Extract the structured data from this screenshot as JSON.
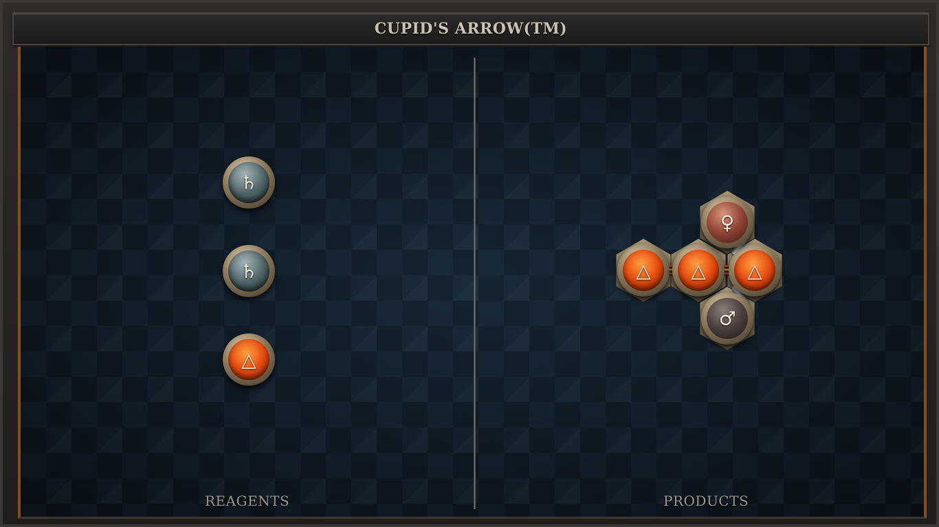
{
  "title": "CUPID'S ARROW(TM)",
  "reagents": {
    "label": "REAGENTS",
    "atoms": [
      {
        "element": "lead",
        "symbol": "♄"
      },
      {
        "element": "lead",
        "symbol": "♄"
      },
      {
        "element": "fire",
        "symbol": "△"
      }
    ]
  },
  "products": {
    "label": "PRODUCTS",
    "molecule": {
      "atoms": [
        {
          "element": "fire",
          "symbol": "△"
        },
        {
          "element": "fire",
          "symbol": "△"
        },
        {
          "element": "fire",
          "symbol": "△"
        },
        {
          "element": "copper",
          "symbol": "♀"
        },
        {
          "element": "iron",
          "symbol": "♂"
        }
      ],
      "bonds": [
        {
          "from": 0,
          "to": 1,
          "type": "triple"
        },
        {
          "from": 1,
          "to": 2,
          "type": "triple"
        },
        {
          "from": 2,
          "to": 3,
          "type": "single"
        },
        {
          "from": 2,
          "to": 4,
          "type": "single"
        }
      ]
    }
  },
  "colors": {
    "board": "#152230",
    "accent_border": "#8a4a22",
    "title_text": "#c9c1b3",
    "label_text": "#9c968c"
  }
}
